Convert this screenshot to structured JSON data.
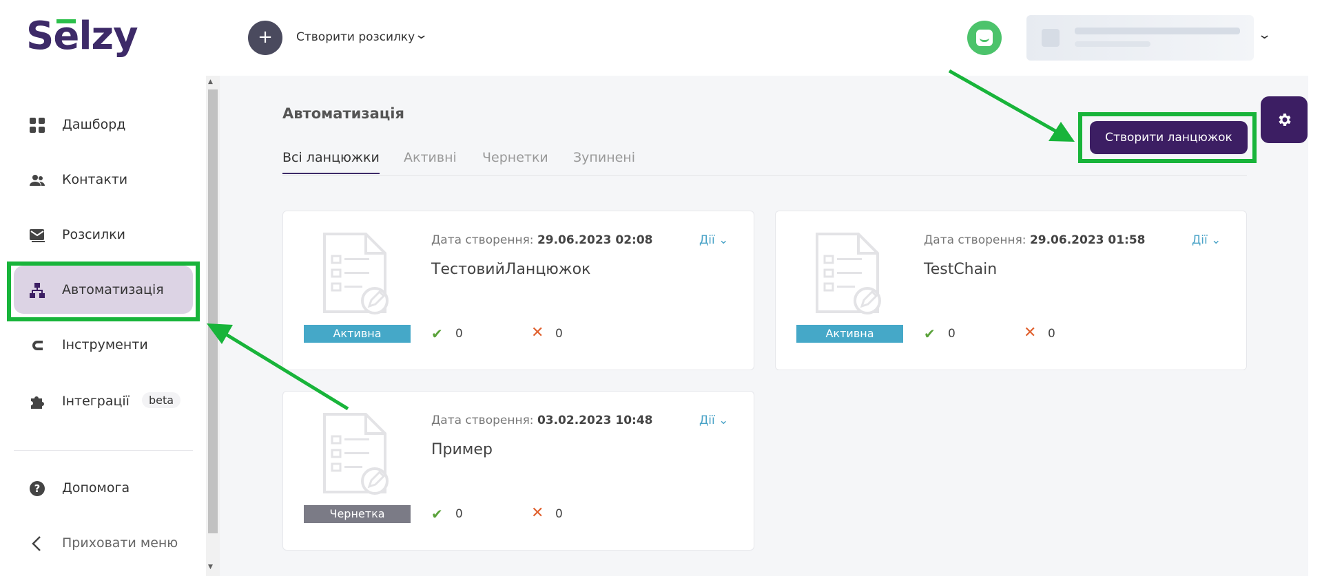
{
  "logo": {
    "text": "Selzy",
    "accent_color": "#2bbf4a",
    "brand_color": "#3d2a68"
  },
  "header": {
    "create_plus": "+",
    "create_label": "Створити розсилку",
    "create_chevron_icon": "chevron-down-icon",
    "account_chevron_icon": "chevron-down-icon"
  },
  "sidebar": {
    "items": [
      {
        "label": "Дашборд",
        "icon": "dashboard-icon"
      },
      {
        "label": "Контакти",
        "icon": "contacts-icon"
      },
      {
        "label": "Розсилки",
        "icon": "mail-icon"
      },
      {
        "label": "Автоматизація",
        "icon": "automation-icon",
        "active": true
      },
      {
        "label": "Інструменти",
        "icon": "magnet-icon"
      },
      {
        "label": "Інтеграції",
        "icon": "puzzle-icon",
        "badge": "beta"
      },
      {
        "label": "Допомога",
        "icon": "help-icon"
      },
      {
        "label": "Приховати меню",
        "icon": "chevron-left-icon"
      }
    ]
  },
  "main": {
    "title": "Автоматизація",
    "tabs": [
      {
        "label": "Всі ланцюжки",
        "active": true
      },
      {
        "label": "Активні"
      },
      {
        "label": "Чернетки"
      },
      {
        "label": "Зупинені"
      }
    ],
    "create_button": "Створити ланцюжок",
    "settings_icon": "gear-icon"
  },
  "cards": [
    {
      "date_label": "Дата створення:",
      "date": "29.06.2023 02:08",
      "name": "ТестовийЛанцюжок",
      "status": "Активна",
      "actions": "Дії",
      "ok_count": "0",
      "fail_count": "0"
    },
    {
      "date_label": "Дата створення:",
      "date": "29.06.2023 01:58",
      "name": "TestChain",
      "status": "Активна",
      "actions": "Дії",
      "ok_count": "0",
      "fail_count": "0"
    },
    {
      "date_label": "Дата створення:",
      "date": "03.02.2023 10:48",
      "name": "Пример",
      "status": "Чернетка",
      "actions": "Дії",
      "ok_count": "0",
      "fail_count": "0"
    }
  ],
  "colors": {
    "accent_purple": "#3c1e63",
    "highlight_green": "#18b43a",
    "status_active": "#45a8c8",
    "status_draft": "#7b7b86"
  }
}
